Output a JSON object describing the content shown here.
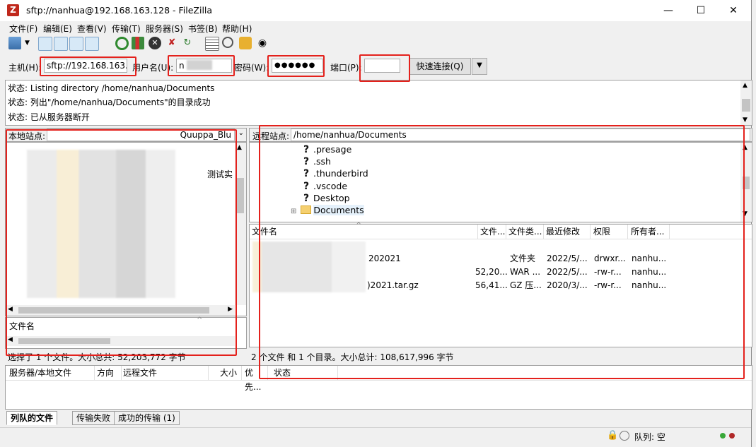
{
  "window": {
    "title": "sftp://nanhua@192.168.163.128 - FileZilla",
    "minimize": "—",
    "maximize": "☐",
    "close": "✕"
  },
  "menu": [
    "文件(F)",
    "编辑(E)",
    "查看(V)",
    "传输(T)",
    "服务器(S)",
    "书签(B)",
    "帮助(H)"
  ],
  "quickconnect": {
    "host_label": "主机(H):",
    "host_value": "sftp://192.168.163.",
    "user_label": "用户名(U):",
    "user_value": "n",
    "pass_label": "密码(W):",
    "pass_value": "●●●●●●",
    "port_label": "端口(P):",
    "port_value": "",
    "connect_button": "快速连接(Q)"
  },
  "log": [
    "状态: Listing directory /home/nanhua/Documents",
    "状态: 列出\"/home/nanhua/Documents\"的目录成功",
    "状态: 已从服务器断开"
  ],
  "local": {
    "site_label": "本地站点:",
    "path_tail": "Quuppa_Blu",
    "partial_text_1": "测试实",
    "filename_header": "文件名",
    "status": "选择了 1 个文件。大小总共: 52,203,772 字节"
  },
  "remote": {
    "site_label": "远程站点:",
    "path": "/home/nanhua/Documents",
    "tree": [
      {
        "name": ".presage",
        "icon": "question-icon"
      },
      {
        "name": ".ssh",
        "icon": "question-icon"
      },
      {
        "name": ".thunderbird",
        "icon": "question-icon"
      },
      {
        "name": ".vscode",
        "icon": "question-icon"
      },
      {
        "name": "Desktop",
        "icon": "question-icon"
      },
      {
        "name": "Documents",
        "icon": "folder-icon"
      }
    ],
    "columns": [
      "文件名",
      "文件...",
      "文件类...",
      "最近修改",
      "权限",
      "所有者..."
    ],
    "rows": [
      {
        "name": "202021",
        "size": "",
        "type": "文件夹",
        "modified": "2022/5/...",
        "perms": "drwxr...",
        "owner": "nanhu..."
      },
      {
        "name": "",
        "size": "52,20...",
        "type": "WAR ...",
        "modified": "2022/5/...",
        "perms": "-rw-r...",
        "owner": "nanhu..."
      },
      {
        "name": ")2021.tar.gz",
        "size": "56,41...",
        "type": "GZ 压...",
        "modified": "2020/3/...",
        "perms": "-rw-r...",
        "owner": "nanhu..."
      }
    ],
    "status": "2 个文件 和 1 个目录。大小总计: 108,617,996 字节"
  },
  "queue": {
    "columns": [
      "服务器/本地文件",
      "方向",
      "远程文件",
      "大小",
      "优先...",
      "状态"
    ],
    "tabs": [
      "列队的文件",
      "传输失败",
      "成功的传输 (1)"
    ]
  },
  "statusbar": {
    "queue": "队列: 空"
  },
  "colors": {
    "highlight": "#e4211c",
    "folder": "#f5d070"
  }
}
